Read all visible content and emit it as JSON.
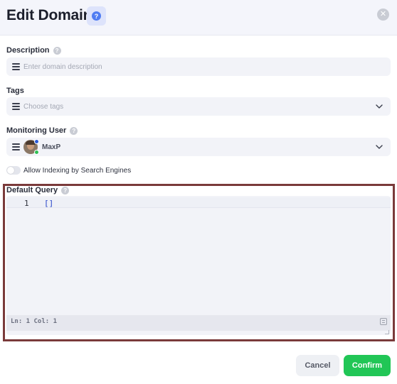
{
  "dialog": {
    "title": "Edit Domain",
    "help_icon": "question-circle-icon",
    "close_icon": "close-icon"
  },
  "description": {
    "label": "Description",
    "placeholder": "Enter domain description",
    "icon": "list-icon"
  },
  "tags": {
    "label": "Tags",
    "placeholder": "Choose tags",
    "icon": "list-icon"
  },
  "monitoring_user": {
    "label": "Monitoring User",
    "value": "MaxP",
    "icon": "list-icon"
  },
  "indexing": {
    "label": "Allow Indexing by Search Engines",
    "enabled": false
  },
  "default_query": {
    "label": "Default Query",
    "lines": [
      {
        "number": "1",
        "code": "[]"
      }
    ],
    "status": "Ln: 1 Col: 1"
  },
  "actions": {
    "cancel": "Cancel",
    "confirm": "Confirm"
  },
  "colors": {
    "accent": "#4f7cf2",
    "confirm": "#21c656",
    "highlight_border": "#7a3a3a"
  }
}
